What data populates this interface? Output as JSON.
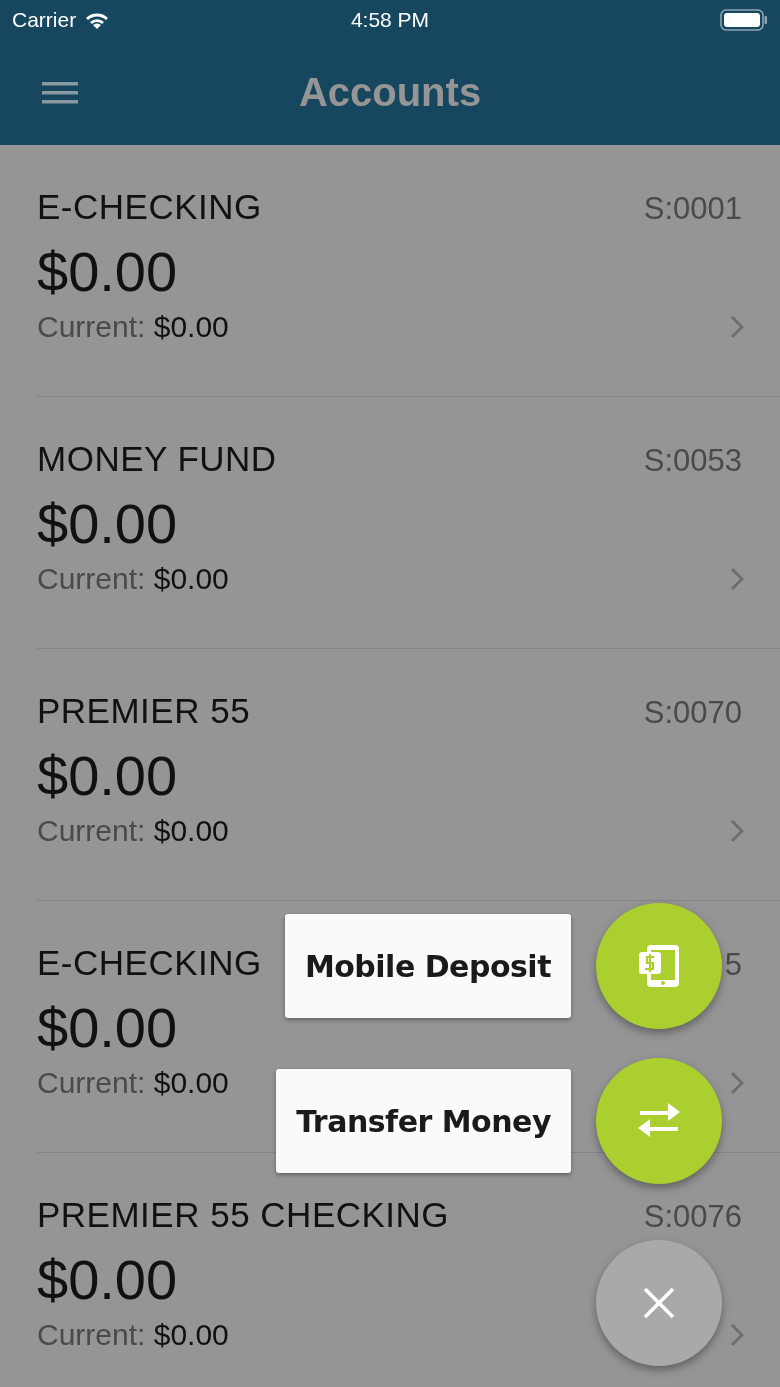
{
  "status_bar": {
    "carrier": "Carrier",
    "time": "4:58 PM"
  },
  "nav_bar": {
    "title": "Accounts"
  },
  "accounts": [
    {
      "name": "E-CHECKING",
      "code": "S:0001",
      "balance": "$0.00",
      "current_label": "Current:",
      "current": "$0.00"
    },
    {
      "name": "MONEY FUND",
      "code": "S:0053",
      "balance": "$0.00",
      "current_label": "Current:",
      "current": "$0.00"
    },
    {
      "name": "PREMIER 55",
      "code": "S:0070",
      "balance": "$0.00",
      "current_label": "Current:",
      "current": "$0.00"
    },
    {
      "name": "E-CHECKING",
      "code": "5",
      "balance": "$0.00",
      "current_label": "Current:",
      "current": "$0.00"
    },
    {
      "name": "PREMIER 55 CHECKING",
      "code": "S:0076",
      "balance": "$0.00",
      "current_label": "Current:",
      "current": "$0.00"
    }
  ],
  "fab_menu": {
    "expanded": true,
    "actions": [
      {
        "kind": "deposit",
        "label": "Mobile Deposit"
      },
      {
        "kind": "transfer",
        "label": "Transfer Money"
      }
    ]
  }
}
